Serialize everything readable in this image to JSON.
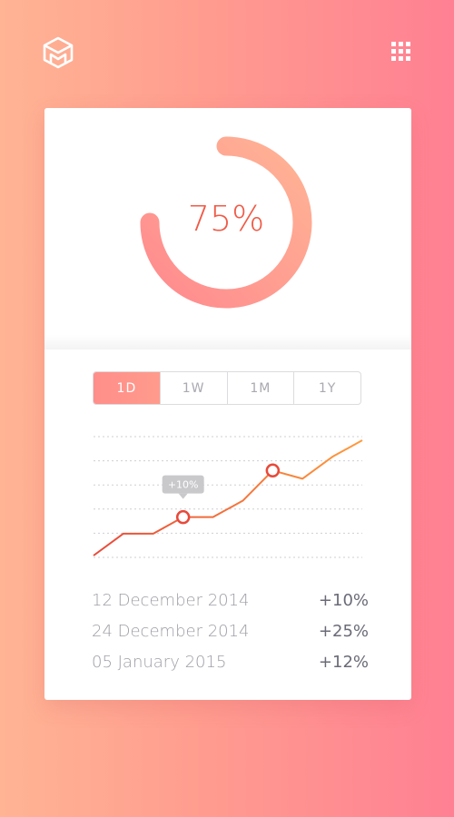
{
  "icons": {
    "logo": "cube-m-logo",
    "menu": "grid-apps-icon"
  },
  "colors": {
    "accent": "#f05a46",
    "ring_start": "#ff8a8e",
    "ring_end": "#ffb495",
    "line_start": "#e8493a",
    "line_end": "#ff9a3c"
  },
  "progress": {
    "value": 0.75,
    "label": "75%"
  },
  "tabs": [
    {
      "label": "1D",
      "active": true
    },
    {
      "label": "1W",
      "active": false
    },
    {
      "label": "1M",
      "active": false
    },
    {
      "label": "1Y",
      "active": false
    }
  ],
  "chart_data": {
    "type": "line",
    "values": [
      0,
      8,
      8,
      14,
      14,
      20,
      31,
      28,
      36,
      42
    ],
    "highlighted_points": [
      3,
      6
    ],
    "tooltip": {
      "point": 3,
      "text": "+10%"
    },
    "ylim": [
      0,
      44
    ],
    "grid": true
  },
  "history": [
    {
      "date": "12 December 2014",
      "change": "+10%"
    },
    {
      "date": "24 December 2014",
      "change": "+25%"
    },
    {
      "date": "05 January 2015",
      "change": "+12%"
    }
  ]
}
